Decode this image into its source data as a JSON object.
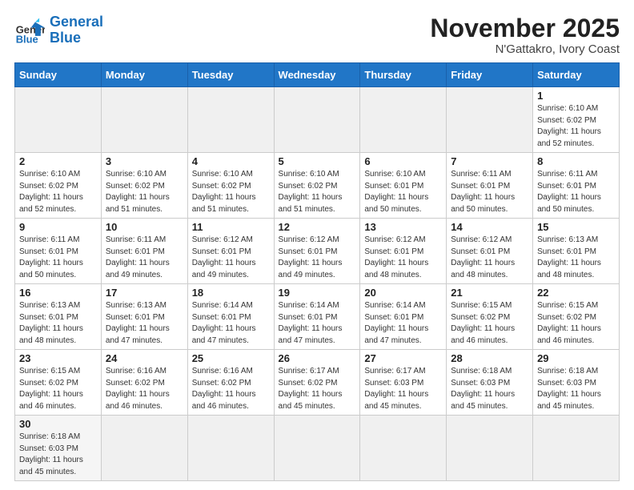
{
  "logo": {
    "name1": "General",
    "name2": "Blue"
  },
  "title": "November 2025",
  "subtitle": "N'Gattakro, Ivory Coast",
  "days_of_week": [
    "Sunday",
    "Monday",
    "Tuesday",
    "Wednesday",
    "Thursday",
    "Friday",
    "Saturday"
  ],
  "weeks": [
    [
      {
        "day": "",
        "info": ""
      },
      {
        "day": "",
        "info": ""
      },
      {
        "day": "",
        "info": ""
      },
      {
        "day": "",
        "info": ""
      },
      {
        "day": "",
        "info": ""
      },
      {
        "day": "",
        "info": ""
      },
      {
        "day": "1",
        "info": "Sunrise: 6:10 AM\nSunset: 6:02 PM\nDaylight: 11 hours\nand 52 minutes."
      }
    ],
    [
      {
        "day": "2",
        "info": "Sunrise: 6:10 AM\nSunset: 6:02 PM\nDaylight: 11 hours\nand 52 minutes."
      },
      {
        "day": "3",
        "info": "Sunrise: 6:10 AM\nSunset: 6:02 PM\nDaylight: 11 hours\nand 51 minutes."
      },
      {
        "day": "4",
        "info": "Sunrise: 6:10 AM\nSunset: 6:02 PM\nDaylight: 11 hours\nand 51 minutes."
      },
      {
        "day": "5",
        "info": "Sunrise: 6:10 AM\nSunset: 6:02 PM\nDaylight: 11 hours\nand 51 minutes."
      },
      {
        "day": "6",
        "info": "Sunrise: 6:10 AM\nSunset: 6:01 PM\nDaylight: 11 hours\nand 50 minutes."
      },
      {
        "day": "7",
        "info": "Sunrise: 6:11 AM\nSunset: 6:01 PM\nDaylight: 11 hours\nand 50 minutes."
      },
      {
        "day": "8",
        "info": "Sunrise: 6:11 AM\nSunset: 6:01 PM\nDaylight: 11 hours\nand 50 minutes."
      }
    ],
    [
      {
        "day": "9",
        "info": "Sunrise: 6:11 AM\nSunset: 6:01 PM\nDaylight: 11 hours\nand 50 minutes."
      },
      {
        "day": "10",
        "info": "Sunrise: 6:11 AM\nSunset: 6:01 PM\nDaylight: 11 hours\nand 49 minutes."
      },
      {
        "day": "11",
        "info": "Sunrise: 6:12 AM\nSunset: 6:01 PM\nDaylight: 11 hours\nand 49 minutes."
      },
      {
        "day": "12",
        "info": "Sunrise: 6:12 AM\nSunset: 6:01 PM\nDaylight: 11 hours\nand 49 minutes."
      },
      {
        "day": "13",
        "info": "Sunrise: 6:12 AM\nSunset: 6:01 PM\nDaylight: 11 hours\nand 48 minutes."
      },
      {
        "day": "14",
        "info": "Sunrise: 6:12 AM\nSunset: 6:01 PM\nDaylight: 11 hours\nand 48 minutes."
      },
      {
        "day": "15",
        "info": "Sunrise: 6:13 AM\nSunset: 6:01 PM\nDaylight: 11 hours\nand 48 minutes."
      }
    ],
    [
      {
        "day": "16",
        "info": "Sunrise: 6:13 AM\nSunset: 6:01 PM\nDaylight: 11 hours\nand 48 minutes."
      },
      {
        "day": "17",
        "info": "Sunrise: 6:13 AM\nSunset: 6:01 PM\nDaylight: 11 hours\nand 47 minutes."
      },
      {
        "day": "18",
        "info": "Sunrise: 6:14 AM\nSunset: 6:01 PM\nDaylight: 11 hours\nand 47 minutes."
      },
      {
        "day": "19",
        "info": "Sunrise: 6:14 AM\nSunset: 6:01 PM\nDaylight: 11 hours\nand 47 minutes."
      },
      {
        "day": "20",
        "info": "Sunrise: 6:14 AM\nSunset: 6:01 PM\nDaylight: 11 hours\nand 47 minutes."
      },
      {
        "day": "21",
        "info": "Sunrise: 6:15 AM\nSunset: 6:02 PM\nDaylight: 11 hours\nand 46 minutes."
      },
      {
        "day": "22",
        "info": "Sunrise: 6:15 AM\nSunset: 6:02 PM\nDaylight: 11 hours\nand 46 minutes."
      }
    ],
    [
      {
        "day": "23",
        "info": "Sunrise: 6:15 AM\nSunset: 6:02 PM\nDaylight: 11 hours\nand 46 minutes."
      },
      {
        "day": "24",
        "info": "Sunrise: 6:16 AM\nSunset: 6:02 PM\nDaylight: 11 hours\nand 46 minutes."
      },
      {
        "day": "25",
        "info": "Sunrise: 6:16 AM\nSunset: 6:02 PM\nDaylight: 11 hours\nand 46 minutes."
      },
      {
        "day": "26",
        "info": "Sunrise: 6:17 AM\nSunset: 6:02 PM\nDaylight: 11 hours\nand 45 minutes."
      },
      {
        "day": "27",
        "info": "Sunrise: 6:17 AM\nSunset: 6:03 PM\nDaylight: 11 hours\nand 45 minutes."
      },
      {
        "day": "28",
        "info": "Sunrise: 6:18 AM\nSunset: 6:03 PM\nDaylight: 11 hours\nand 45 minutes."
      },
      {
        "day": "29",
        "info": "Sunrise: 6:18 AM\nSunset: 6:03 PM\nDaylight: 11 hours\nand 45 minutes."
      }
    ],
    [
      {
        "day": "30",
        "info": "Sunrise: 6:18 AM\nSunset: 6:03 PM\nDaylight: 11 hours\nand 45 minutes."
      },
      {
        "day": "",
        "info": ""
      },
      {
        "day": "",
        "info": ""
      },
      {
        "day": "",
        "info": ""
      },
      {
        "day": "",
        "info": ""
      },
      {
        "day": "",
        "info": ""
      },
      {
        "day": "",
        "info": ""
      }
    ]
  ]
}
